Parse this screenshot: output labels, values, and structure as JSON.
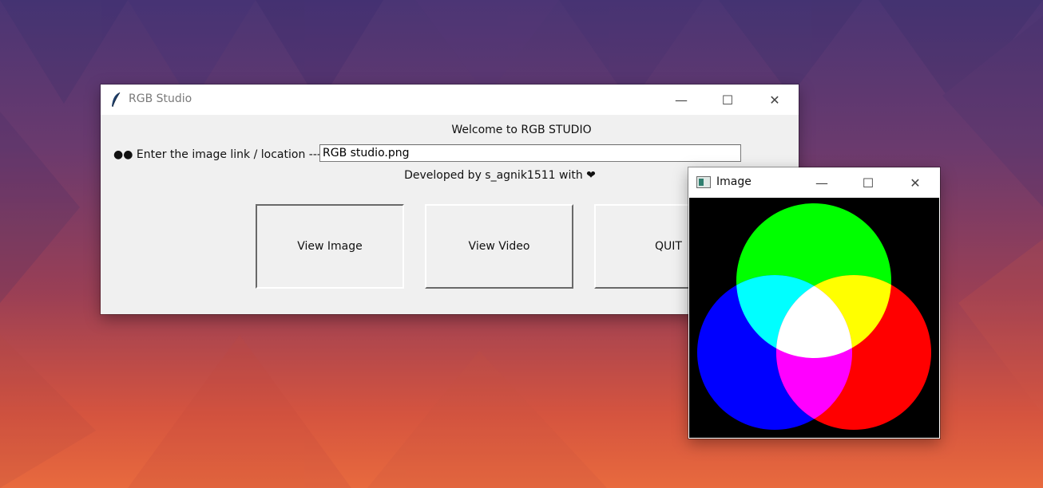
{
  "main_window": {
    "title": "RGB Studio",
    "welcome": "Welcome to RGB STUDIO",
    "input_label": "●● Enter the image link / location --->",
    "input_value": "RGB studio.png",
    "developer_text": "Developed by s_agnik1511 with ❤",
    "buttons": {
      "view_image": "View Image",
      "view_video": "View Video",
      "quit": "QUIT"
    }
  },
  "image_window": {
    "title": "Image"
  },
  "controls": {
    "minimize": "—",
    "maximize": "☐",
    "close": "✕"
  },
  "colors": {
    "red": "#ff0000",
    "green": "#00ff00",
    "blue": "#0000ff",
    "cyan": "#00ffff",
    "yellow": "#ffff00",
    "magenta": "#ff00ff",
    "white": "#ffffff"
  }
}
